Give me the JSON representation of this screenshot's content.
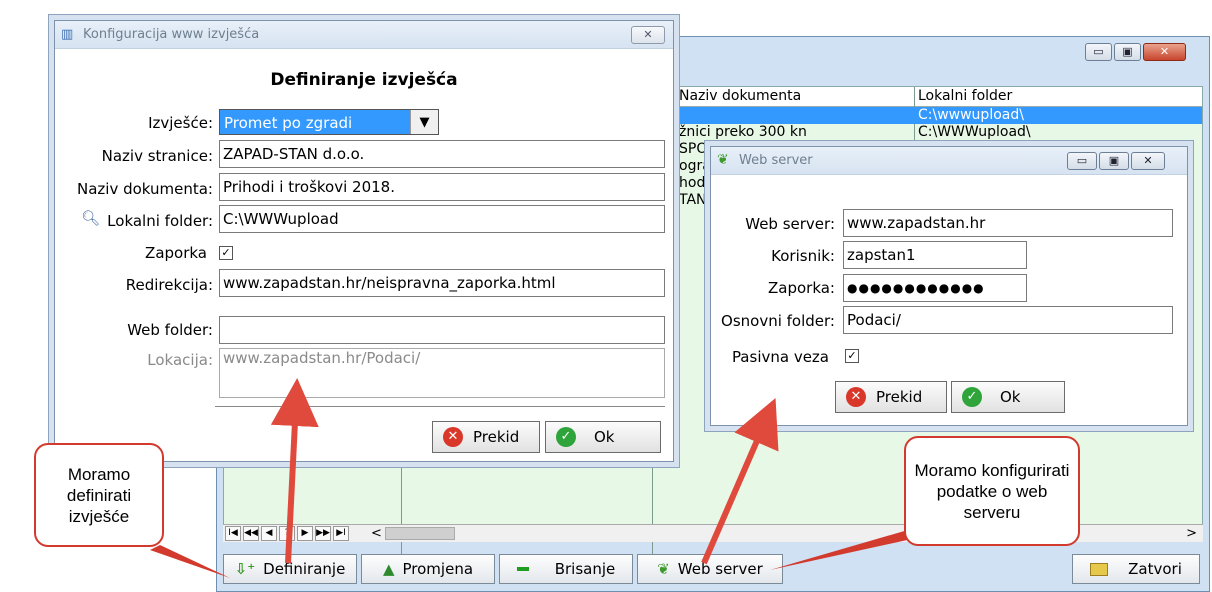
{
  "main_window": {
    "grid_headers": [
      "Naziv dokumenta",
      "Lokalni folder"
    ],
    "rows": [
      {
        "naziv": "",
        "folder": "C:\\wwwupload\\",
        "selected": true
      },
      {
        "naziv": "žnici preko 300 kn",
        "folder": "C:\\WWWupload\\"
      },
      {
        "naziv": "SPO",
        "folder": ""
      },
      {
        "naziv": "ogra",
        "folder": ""
      },
      {
        "naziv": "hod",
        "folder": ""
      },
      {
        "naziv": "TAN",
        "folder": ""
      }
    ],
    "nav_buttons": [
      "I◀",
      "◀◀",
      "◀",
      "?",
      "▶",
      "▶▶",
      "▶I"
    ],
    "scroll_left": "<",
    "scroll_right": ">",
    "buttons": {
      "definiranje": "Definiranje",
      "promjena": "Promjena",
      "brisanje": "Brisanje",
      "web_server": "Web server",
      "zatvori": "Zatvori"
    },
    "window_controls": {
      "minimize": "▭",
      "maximize": "▣",
      "close": "✕"
    }
  },
  "config_dialog": {
    "title": "Konfiguracija www izvješća",
    "heading": "Definiranje izvješća",
    "close_glyph": "✕",
    "labels": {
      "izvjesce": "Izvješće:",
      "naziv_stranice": "Naziv stranice:",
      "naziv_dokumenta": "Naziv dokumenta:",
      "lokalni_folder": "Lokalni folder:",
      "zaporka": "Zaporka",
      "redirekcija": "Redirekcija:",
      "web_folder": "Web folder:",
      "lokacija": "Lokacija:"
    },
    "values": {
      "izvjesce": "Promet po zgradi",
      "naziv_stranice": "ZAPAD-STAN d.o.o.",
      "naziv_dokumenta": "Prihodi i troškovi 2018.",
      "lokalni_folder": "C:\\WWWupload",
      "zaporka_checked": true,
      "redirekcija": "www.zapadstan.hr/neispravna_zaporka.html",
      "web_folder": "",
      "lokacija": "www.zapadstan.hr/Podaci/"
    },
    "buttons": {
      "prekid": "Prekid",
      "ok": "Ok"
    }
  },
  "web_dialog": {
    "title": "Web server",
    "window_controls": {
      "minimize": "▭",
      "maximize": "▣",
      "close": "✕"
    },
    "labels": {
      "web_server": "Web server:",
      "korisnik": "Korisnik:",
      "zaporka": "Zaporka:",
      "osnovni_folder": "Osnovni folder:",
      "pasivna_veza": "Pasivna veza"
    },
    "values": {
      "web_server": "www.zapadstan.hr",
      "korisnik": "zapstan1",
      "zaporka": "●●●●●●●●●●●●",
      "osnovni_folder": "Podaci/",
      "pasivna_veza_checked": true
    },
    "buttons": {
      "prekid": "Prekid",
      "ok": "Ok"
    }
  },
  "callouts": {
    "left": "Moramo definirati izvješće",
    "right": "Moramo konfigurirati podatke o web serveru"
  },
  "glyphs": {
    "check": "✓",
    "dropdown": "▼",
    "ok_icon": "✓",
    "cancel_icon": "✕"
  },
  "colors": {
    "selection": "#3399ff",
    "grid_bg": "#e8f8e6",
    "callout_border": "#d33a2e",
    "arrow": "#e04a3c"
  }
}
